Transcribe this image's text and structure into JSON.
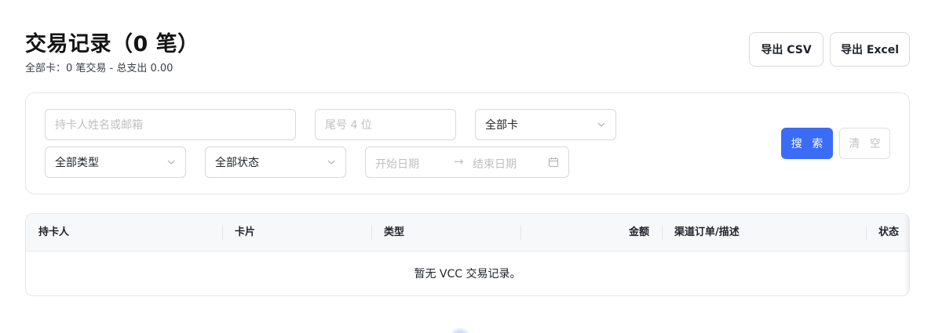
{
  "header": {
    "title": "交易记录（0 笔）",
    "subtitle": "全部卡：0 笔交易 - 总支出 0.00",
    "export_csv_label": "导出 CSV",
    "export_excel_label": "导出 Excel"
  },
  "filters": {
    "name_placeholder": "持卡人姓名或邮箱",
    "tail_placeholder": "尾号 4 位",
    "card_select": "全部卡",
    "type_select": "全部类型",
    "status_select": "全部状态",
    "start_date_placeholder": "开始日期",
    "range_arrow": "→",
    "end_date_placeholder": "结束日期",
    "search_label": "搜 索",
    "clear_label": "清 空"
  },
  "table": {
    "columns": [
      "持卡人",
      "卡片",
      "类型",
      "金额",
      "渠道订单/描述",
      "状态"
    ],
    "empty_text": "暂无 VCC 交易记录。"
  },
  "colors": {
    "primary": "#3b6cf6",
    "border": "#d9d9d9",
    "header_bg": "#f7f8fa"
  },
  "icons": {
    "select": "chevron-down-icon",
    "date": "calendar-icon",
    "loading": "loading-spinner-icon"
  }
}
